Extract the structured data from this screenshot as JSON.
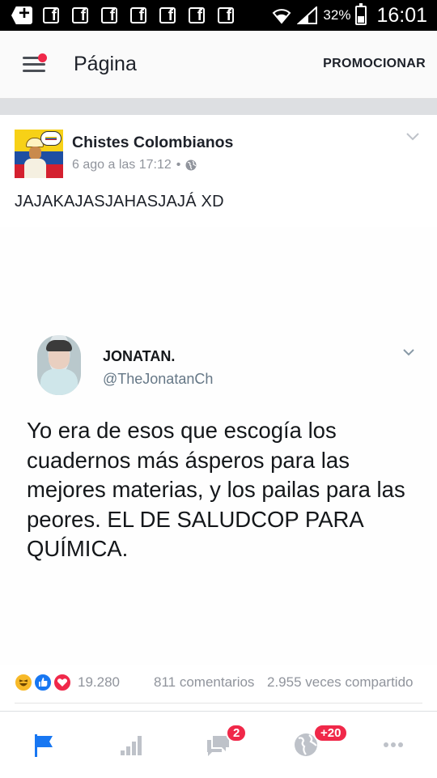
{
  "status_bar": {
    "battery": "32%",
    "time": "16:01"
  },
  "app_bar": {
    "title": "Página",
    "promote_label": "PROMOCIONAR"
  },
  "post": {
    "page_name": "Chistes Colombianos",
    "timestamp": "6 ago a las 17:12",
    "separator": "•",
    "text": "JAJAKAJASJAHASJAJÁ XD",
    "tweet": {
      "name": "JONATAN.",
      "handle": "@TheJonatanCh",
      "body": "Yo era de esos que escogía los cuadernos más ásperos para las mejores materias, y los pailas para las peores. EL DE SALUDCOP PARA QUÍMICA."
    },
    "reactions_count": "19.280",
    "comments": "811 comentarios",
    "shares": "2.955 veces compartido"
  },
  "bottom_nav": {
    "messages_badge": "2",
    "notifications_badge": "+20"
  },
  "colors": {
    "accent": "#1877f2",
    "badge": "#f02849",
    "text": "#1d2129",
    "secondary_text": "#90949c"
  }
}
